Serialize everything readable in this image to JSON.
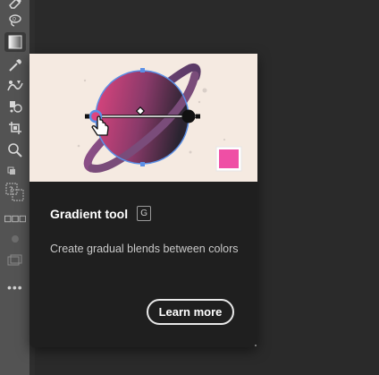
{
  "toolbar": {
    "tools": [
      {
        "name": "eraser-tool",
        "icon": "eraser-icon"
      },
      {
        "name": "lasso-tool",
        "icon": "lasso-icon"
      },
      {
        "name": "gradient-tool",
        "icon": "gradient-icon",
        "selected": true
      },
      {
        "name": "eyedropper-tool",
        "icon": "eyedropper-icon"
      },
      {
        "name": "blend-tool",
        "icon": "blend-icon"
      },
      {
        "name": "symbol-sprayer-tool",
        "icon": "symbol-sprayer-icon"
      },
      {
        "name": "artboard-tool",
        "icon": "artboard-icon"
      },
      {
        "name": "zoom-tool",
        "icon": "zoom-icon"
      }
    ],
    "more_label": "•••"
  },
  "tooltip": {
    "title": "Gradient tool",
    "shortcut": "G",
    "description": "Create gradual blends between colors",
    "button_label": "Learn more",
    "colors": {
      "illustration_bg": "#f5eae1",
      "planet_start": "#e0457f",
      "planet_end": "#2a2430",
      "ring": "#7a4c7a",
      "swatch": "#ef4fa5",
      "selection": "#5b8fe6"
    }
  }
}
